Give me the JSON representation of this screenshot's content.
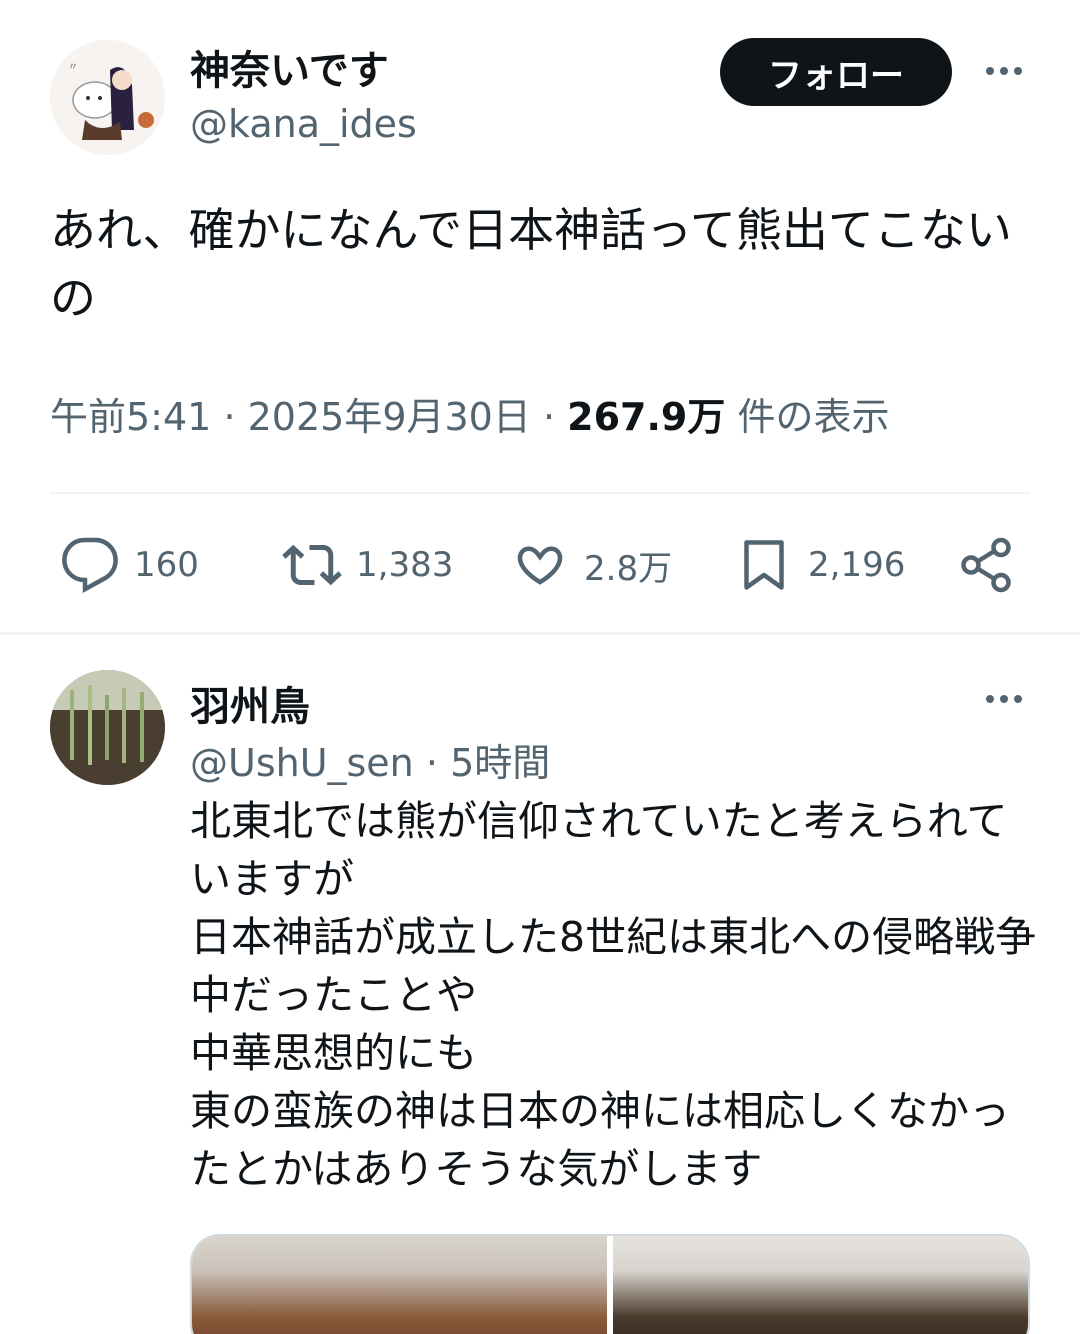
{
  "tweet": {
    "author": {
      "name": "神奈いです",
      "handle": "@kana_ides"
    },
    "follow_label": "フォロー",
    "text": "あれ、確かになんで日本神話って熊出てこないの",
    "meta": {
      "time": "午前5:41",
      "date": "2025年9月30日",
      "views_count": "267.9万",
      "views_label": "件の表示",
      "separator": "·"
    },
    "actions": {
      "replies": "160",
      "retweets": "1,383",
      "likes": "2.8万",
      "bookmarks": "2,196"
    }
  },
  "reply": {
    "author": {
      "name": "羽州鳥",
      "handle": "@UshU_sen",
      "time": "5時間"
    },
    "separator": "·",
    "text": "北東北では熊が信仰されていたと考えられていますが\n日本神話が成立した8世紀は東北への侵略戦争中だったことや\n中華思想的にも\n東の蛮族の神は日本の神には相応しくなかったとかはありそうな気がします"
  },
  "icons": {
    "reply": "reply-icon",
    "retweet": "retweet-icon",
    "like": "heart-icon",
    "bookmark": "bookmark-icon",
    "share": "share-icon",
    "more": "more-icon"
  },
  "colors": {
    "text_primary": "#0f1419",
    "text_secondary": "#536471",
    "divider": "#eff3f4",
    "follow_bg": "#0f1419"
  }
}
